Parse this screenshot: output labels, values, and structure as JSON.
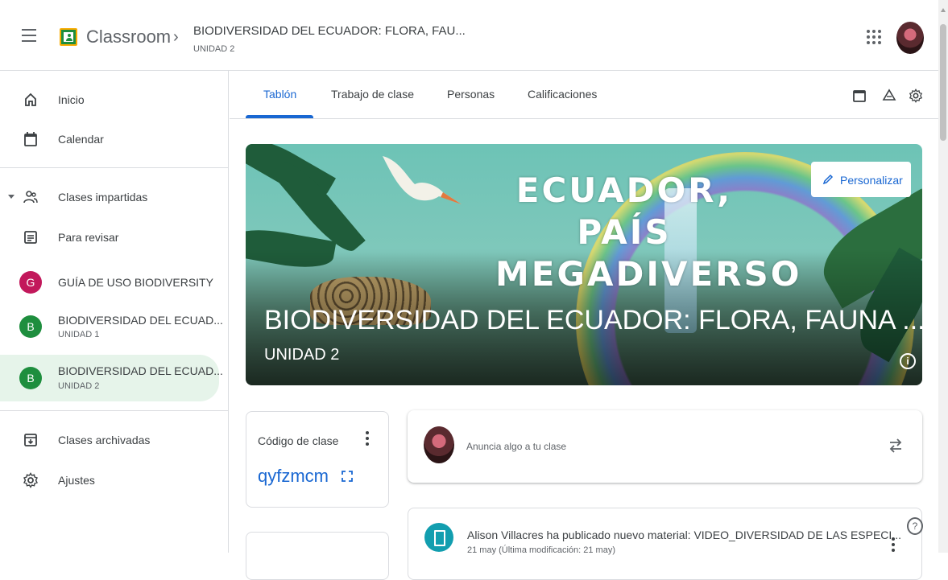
{
  "header": {
    "app_name": "Classroom",
    "breadcrumb_separator": "›",
    "class_title": "BIODIVERSIDAD DEL ECUADOR: FLORA, FAU...",
    "class_section": "UNIDAD 2",
    "icons": [
      "menu-icon",
      "classroom-logo-icon",
      "apps-grid-icon",
      "account-avatar"
    ]
  },
  "sidebar": {
    "items": [
      {
        "label": "Inicio",
        "icon": "home-icon"
      },
      {
        "label": "Calendar",
        "icon": "calendar-icon"
      },
      {
        "label": "Clases impartidas",
        "icon": "people-icon"
      },
      {
        "label": "Para revisar",
        "icon": "review-list-icon"
      },
      {
        "label": "GUÍA DE USO BIODIVERSITY",
        "letter": "G",
        "color": "#c2185b"
      },
      {
        "label": "BIODIVERSIDAD DEL ECUAD...",
        "sub": "UNIDAD 1",
        "letter": "B",
        "color": "#1e8e3e"
      },
      {
        "label": "BIODIVERSIDAD DEL ECUAD...",
        "sub": "UNIDAD 2",
        "letter": "B",
        "color": "#1e8e3e",
        "active": true
      },
      {
        "label": "Clases archivadas",
        "icon": "archive-icon"
      },
      {
        "label": "Ajustes",
        "icon": "gear-icon"
      }
    ]
  },
  "tabs": [
    {
      "label": "Tablón",
      "active": true
    },
    {
      "label": "Trabajo de clase"
    },
    {
      "label": "Personas"
    },
    {
      "label": "Calificaciones"
    }
  ],
  "tab_tools": [
    "calendar-icon",
    "drive-icon",
    "gear-icon"
  ],
  "banner": {
    "art_title_line1": "ECUADOR, PAÍS",
    "art_title_line2": "MEGADIVERSO",
    "title": "BIODIVERSIDAD DEL ECUADOR: FLORA, FAUNA ...",
    "subtitle": "UNIDAD 2",
    "customize_label": "Personalizar",
    "colors": {
      "sky": "#7fc8bb",
      "accent": "#1967d2"
    }
  },
  "class_code": {
    "label": "Código de clase",
    "code": "qyfzmcm"
  },
  "announce": {
    "placeholder": "Anuncia algo a tu clase"
  },
  "post": {
    "text": "Alison Villacres ha publicado nuevo material: VIDEO_DIVERSIDAD DE LAS ESPECI...",
    "meta": "21 may (Última modificación: 21 may)"
  },
  "colors": {
    "accent": "#1967d2",
    "active_bg": "#e6f4ea",
    "classroom_green": "#1e8e3e"
  }
}
